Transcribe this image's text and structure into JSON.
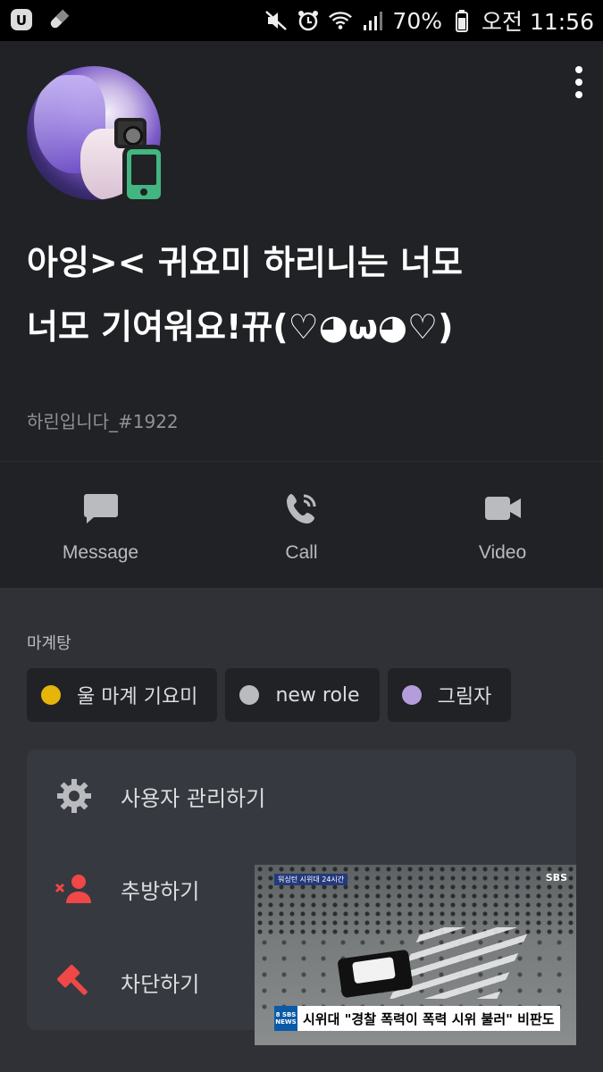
{
  "status_bar": {
    "battery_percent": "70%",
    "time": "오전 11:56"
  },
  "profile": {
    "username": "아잉>< 귀요미 하리니는 너모너모 기여워요!뀨(♡◕ω◕♡)",
    "tag": "하린입니다_#1922",
    "status": "mobile-online"
  },
  "actions": [
    {
      "label": "Message",
      "icon": "message-icon"
    },
    {
      "label": "Call",
      "icon": "call-icon"
    },
    {
      "label": "Video",
      "icon": "video-icon"
    }
  ],
  "server": {
    "name": "마계탕",
    "roles": [
      {
        "name": "울 마계 기요미",
        "color": "#e5b50a"
      },
      {
        "name": "new role",
        "color": "#b9bbbe"
      },
      {
        "name": "그림자",
        "color": "#b39ddb"
      }
    ]
  },
  "menu": [
    {
      "label": "사용자 관리하기",
      "icon": "gear-icon"
    },
    {
      "label": "추방하기",
      "icon": "kick-user-icon"
    },
    {
      "label": "차단하기",
      "icon": "ban-hammer-icon"
    }
  ],
  "video_overlay": {
    "top_label": "워싱턴 시위대 24시간",
    "channel": "SBS",
    "logo": "8 SBS NEWS",
    "caption": "시위대 \"경찰 폭력이 폭력 시위 불러\" 비판도"
  },
  "colors": {
    "online_mobile": "#43b581",
    "danger": "#f04747"
  }
}
